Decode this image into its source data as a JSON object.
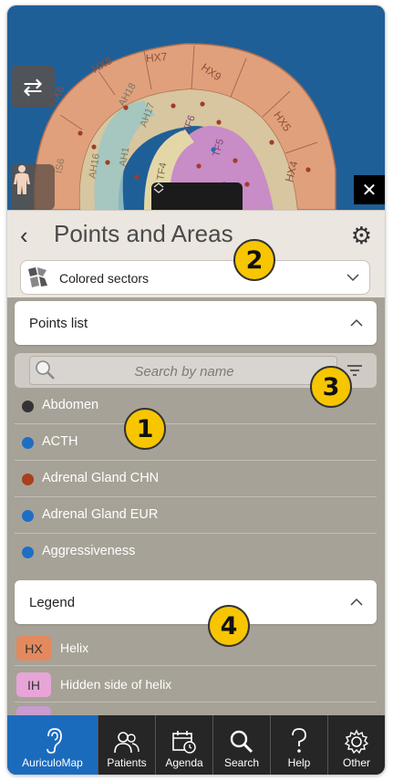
{
  "map": {
    "zones": [
      "HX8",
      "HX7",
      "HX9",
      "HX6",
      "HX5",
      "HX4",
      "AH18",
      "AH17",
      "AH16",
      "AH1",
      "TF6",
      "TF5",
      "TF4",
      "IS6"
    ],
    "close_glyph": "✕",
    "swap_glyph": "⇄"
  },
  "panel": {
    "title": "Points and Areas",
    "back_glyph": "‹",
    "gear_glyph": "⚙",
    "dropdown_label": "Colored sectors"
  },
  "points_list": {
    "title": "Points list",
    "search_placeholder": "Search by name",
    "items": [
      {
        "name": "Abdomen",
        "color": "#333333"
      },
      {
        "name": "ACTH",
        "color": "#1d6fc4"
      },
      {
        "name": "Adrenal Gland CHN",
        "color": "#a8401c"
      },
      {
        "name": "Adrenal Gland EUR",
        "color": "#1d6fc4"
      },
      {
        "name": "Aggressiveness",
        "color": "#1d6fc4"
      }
    ]
  },
  "legend": {
    "title": "Legend",
    "items": [
      {
        "code": "HX",
        "name": "Helix",
        "color": "#e3895d"
      },
      {
        "code": "IH",
        "name": "Hidden side of helix",
        "color": "#e7a5d7"
      }
    ]
  },
  "badges": [
    "1",
    "2",
    "3",
    "4"
  ],
  "tabs": [
    {
      "label": "AuriculoMap",
      "icon": "ear-icon",
      "active": true
    },
    {
      "label": "Patients",
      "icon": "patients-icon",
      "active": false
    },
    {
      "label": "Agenda",
      "icon": "calendar-icon",
      "active": false
    },
    {
      "label": "Search",
      "icon": "search-icon",
      "active": false
    },
    {
      "label": "Help",
      "icon": "help-icon",
      "active": false
    },
    {
      "label": "Other",
      "icon": "gear-icon",
      "active": false
    }
  ]
}
